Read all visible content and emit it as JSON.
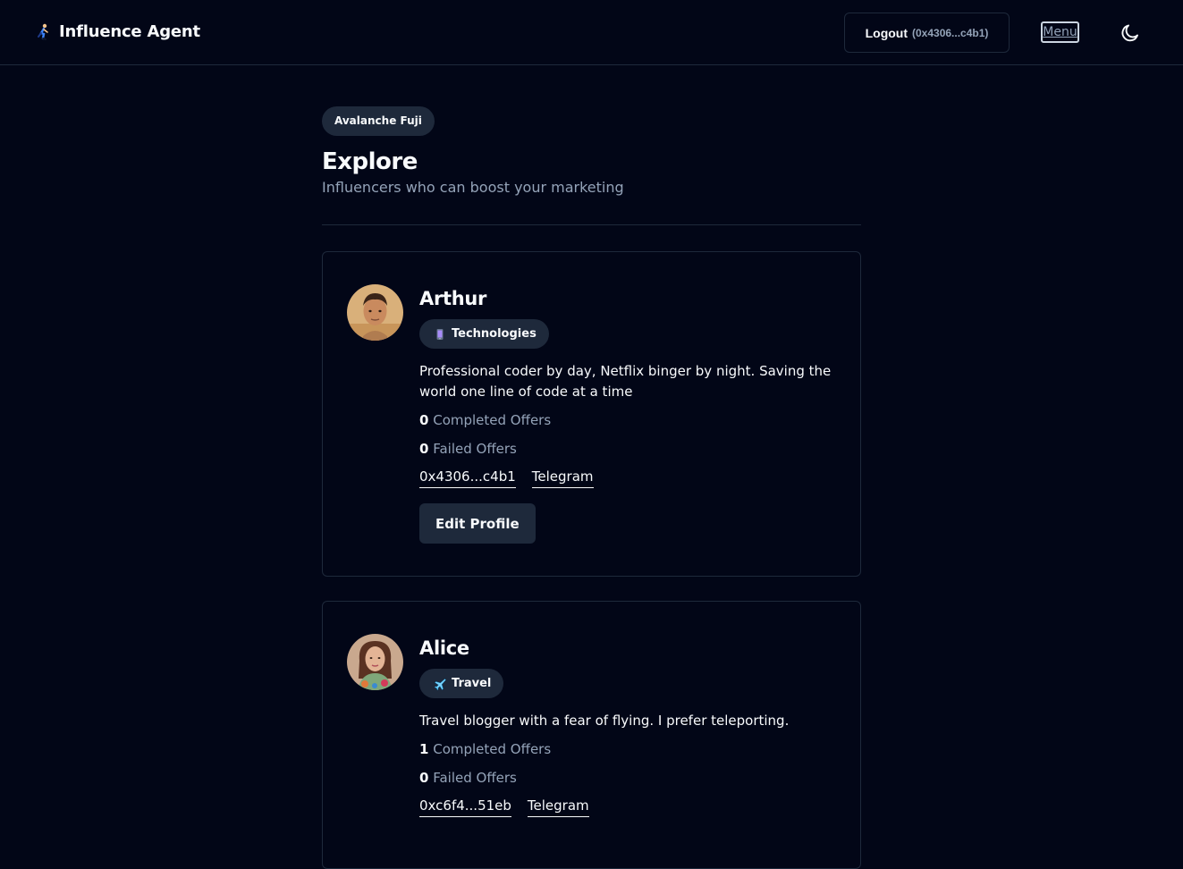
{
  "header": {
    "brand_title": "Influence Agent",
    "logout_label": "Logout",
    "logout_address": "(0x4306...c4b1)",
    "menu_label": "Menu"
  },
  "main": {
    "network_badge": "Avalanche Fuji",
    "title": "Explore",
    "subtitle": "Influencers who can boost your marketing"
  },
  "influencers": [
    {
      "name": "Arthur",
      "category": "Technologies",
      "category_icon": "phone-icon",
      "bio": "Professional coder by day, Netflix binger by night. Saving the world one line of code at a time",
      "completed_count": "0",
      "completed_label": "Completed Offers",
      "failed_count": "0",
      "failed_label": "Failed Offers",
      "address": "0x4306...c4b1",
      "telegram_label": "Telegram",
      "edit_label": "Edit Profile"
    },
    {
      "name": "Alice",
      "category": "Travel",
      "category_icon": "airplane-icon",
      "bio": "Travel blogger with a fear of flying. I prefer teleporting.",
      "completed_count": "1",
      "completed_label": "Completed Offers",
      "failed_count": "0",
      "failed_label": "Failed Offers",
      "address": "0xc6f4...51eb",
      "telegram_label": "Telegram"
    }
  ],
  "colors": {
    "background": "#020617",
    "border": "#1e293b",
    "muted_text": "#94a3b8",
    "badge_bg": "#1e293b"
  }
}
